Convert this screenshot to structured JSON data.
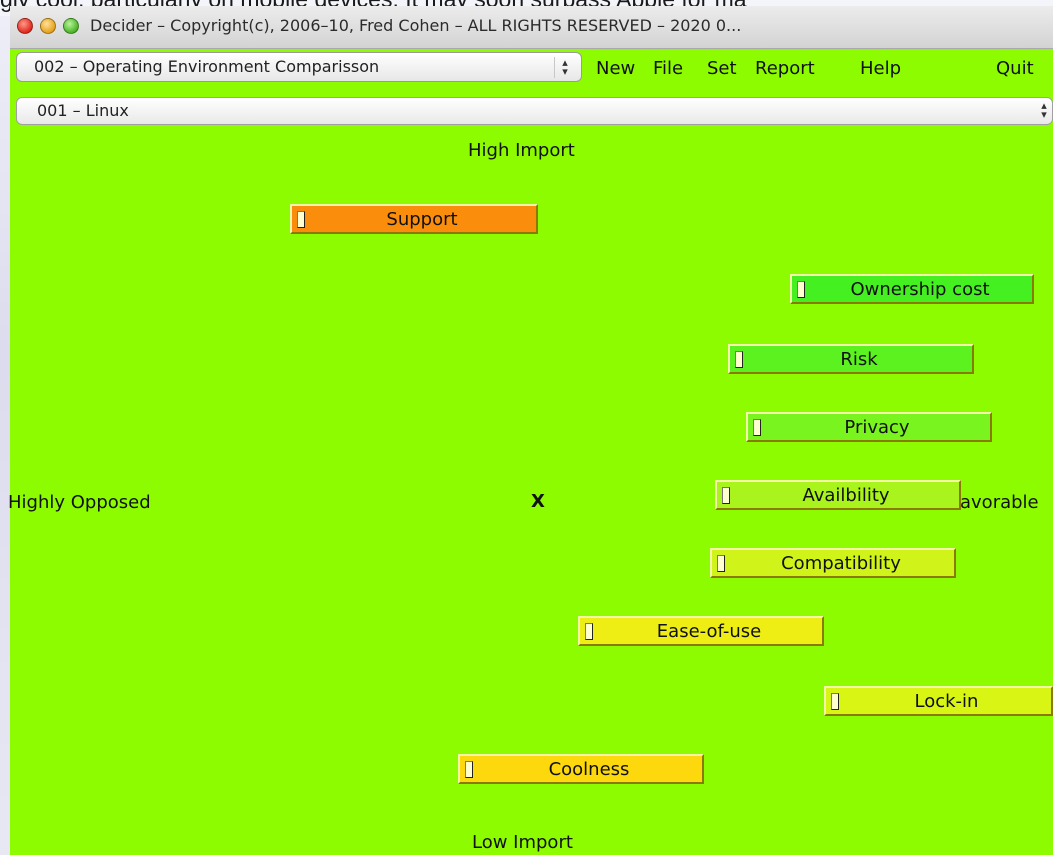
{
  "background_text": "gly cool, particularly on mobile devices. It may soon surpass Apple for ma",
  "window": {
    "title": "Decider – Copyright(c), 2006–10, Fred Cohen – ALL RIGHTS RESERVED – 2020 0..."
  },
  "toolbar": {
    "project_select": "002 – Operating Environment Comparisson",
    "menu": [
      "New",
      "File",
      "Set",
      "Report",
      "Help",
      "Quit"
    ]
  },
  "alternative_select": "001 – Linux",
  "axes": {
    "top": "High Import",
    "bottom": "Low Import",
    "left": "Highly Opposed",
    "right": "avorable",
    "origin": "X"
  },
  "factors": [
    {
      "label": "Support",
      "color": "#fa8d0c"
    },
    {
      "label": "Ownership cost",
      "color": "#45f020"
    },
    {
      "label": "Risk",
      "color": "#5cf220"
    },
    {
      "label": "Privacy",
      "color": "#7af41e"
    },
    {
      "label": "Availbility",
      "color": "#a8f41c"
    },
    {
      "label": "Compatibility",
      "color": "#d0f31a"
    },
    {
      "label": "Ease-of-use",
      "color": "#eeee14"
    },
    {
      "label": "Lock-in",
      "color": "#d8f514"
    },
    {
      "label": "Coolness",
      "color": "#fcd80c"
    }
  ],
  "colors": {
    "canvas": "#8efc00"
  }
}
